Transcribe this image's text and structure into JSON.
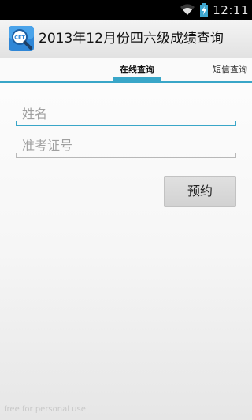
{
  "status_bar": {
    "time": "12:11",
    "icons": [
      "wifi-icon",
      "battery-charging-icon"
    ]
  },
  "action_bar": {
    "app_icon": "cet-magnifier-icon",
    "app_icon_text": "CET",
    "title": "2013年12月份四六级成绩查询"
  },
  "tabs": [
    {
      "label": "在线查询",
      "selected": true
    },
    {
      "label": "短信查询",
      "selected": false
    }
  ],
  "form": {
    "name_placeholder": "姓名",
    "name_value": "",
    "exam_id_placeholder": "准考证号",
    "exam_id_value": "",
    "submit_label": "预约"
  },
  "watermark": "free for personal use",
  "colors": {
    "accent": "#39a6c8",
    "status_bar": "#000000"
  }
}
